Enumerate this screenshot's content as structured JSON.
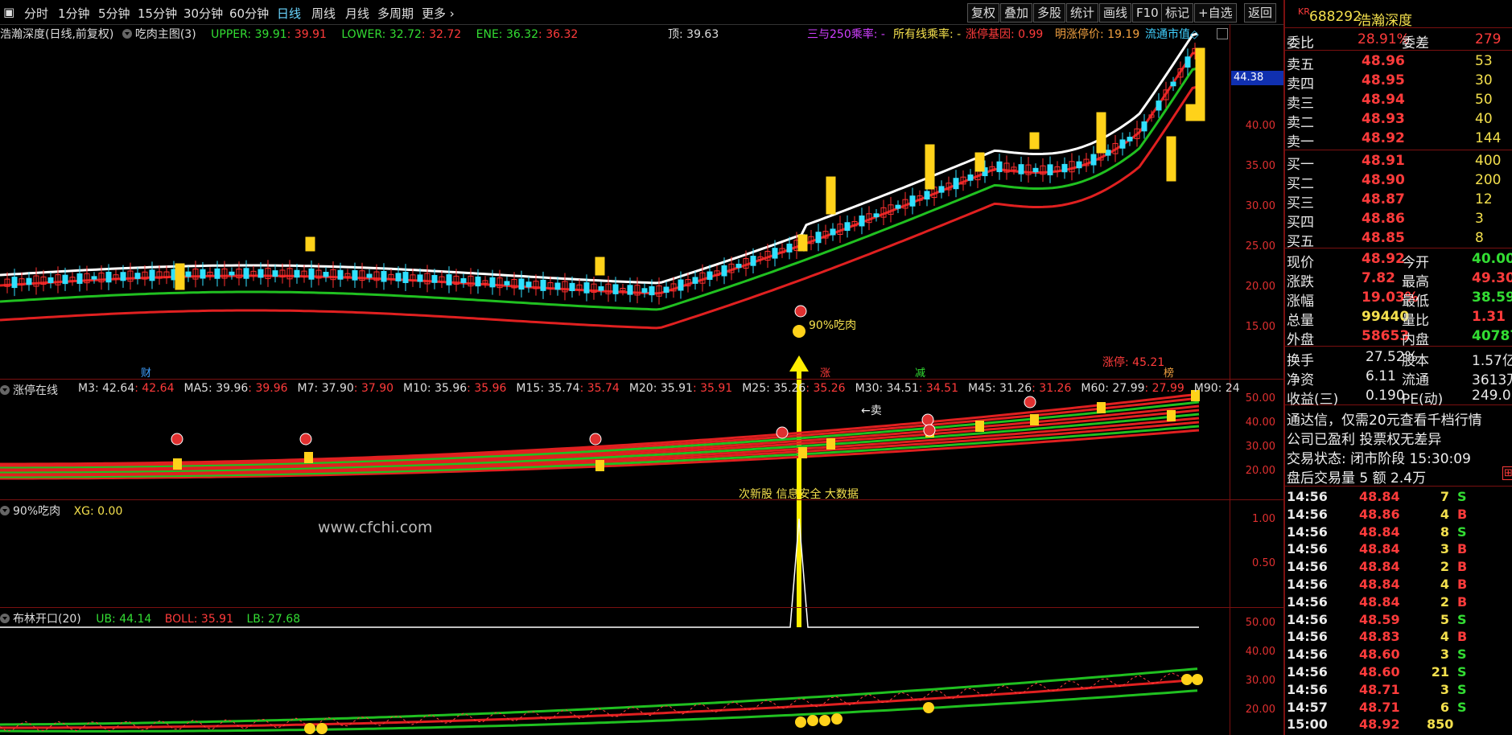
{
  "toolbar": {
    "period_tabs": [
      "分时",
      "1分钟",
      "5分钟",
      "15分钟",
      "30分钟",
      "60分钟",
      "日线",
      "周线",
      "月线",
      "多周期",
      "更多"
    ],
    "active_tab": "日线",
    "right_buttons": [
      "复权",
      "叠加",
      "多股",
      "统计",
      "画线",
      "F10",
      "标记",
      "+自选",
      "返回"
    ]
  },
  "main_panel": {
    "title": "浩瀚深度(日线,前复权)",
    "indicator_name": "吃肉主图(3)",
    "upper_label": "UPPER: 39.91",
    "upper_val": ": 39.91",
    "lower_label": "LOWER: 32.72",
    "lower_val": ": 32.72",
    "ene_label": "ENE: 36.32",
    "ene_val": ": 36.32",
    "top_label": "顶: 39.63",
    "extra1": "三与250乘率: -",
    "extra2": "所有线乘率: -",
    "extra3": "涨停基因: 0.99",
    "extra4": "明涨停价: 19.19",
    "extra5": "流通市值◇",
    "price_tag": "44.38",
    "signal_text": "90%吃肉",
    "limit_text": "涨停: 45.21",
    "marker_cai": "财",
    "marker_zhang": "涨",
    "marker_jian": "减",
    "marker_bang": "榜",
    "y_ticks": [
      "40.00",
      "35.00",
      "30.00",
      "25.00",
      "20.00",
      "15.00"
    ]
  },
  "panel2": {
    "name": "涨停在线",
    "ma": [
      {
        "l": "M3: 42.64",
        "v": ": 42.64"
      },
      {
        "l": "MA5: 39.96",
        "v": ": 39.96"
      },
      {
        "l": "M7: 37.90",
        "v": ": 37.90"
      },
      {
        "l": "M10: 35.96",
        "v": ": 35.96"
      },
      {
        "l": "M15: 35.74",
        "v": ": 35.74"
      },
      {
        "l": "M20: 35.91",
        "v": ": 35.91"
      },
      {
        "l": "M25: 35.26",
        "v": ": 35.26"
      },
      {
        "l": "M30: 34.51",
        "v": ": 34.51"
      },
      {
        "l": "M45: 31.26",
        "v": ": 31.26"
      },
      {
        "l": "M60: 27.99",
        "v": ": 27.99"
      },
      {
        "l": "M90: 24",
        "v": ""
      }
    ],
    "sell_text": "←卖",
    "news_text": "次新股 信息安全 大数据",
    "y_ticks": [
      "50.00",
      "40.00",
      "30.00",
      "20.00"
    ]
  },
  "panel3": {
    "name": "90%吃肉",
    "xg": "XG: 0.00",
    "watermark": "www.cfchi.com",
    "y_ticks": [
      "1.00",
      "0.50"
    ]
  },
  "panel4": {
    "name": "布林开口(20)",
    "ub": "UB: 44.14",
    "boll": "BOLL: 35.91",
    "lb": "LB: 27.68",
    "y_ticks": [
      "50.00",
      "40.00",
      "30.00",
      "20.00"
    ]
  },
  "quote": {
    "code_prefix": "KR",
    "code": "688292",
    "name": "浩瀚深度",
    "weibi_label": "委比",
    "weibi_val": "28.91%",
    "weicha_label": "委差",
    "weicha_val": "279",
    "asks": [
      {
        "l": "卖五",
        "p": "48.96",
        "v": "53"
      },
      {
        "l": "卖四",
        "p": "48.95",
        "v": "30"
      },
      {
        "l": "卖三",
        "p": "48.94",
        "v": "50"
      },
      {
        "l": "卖二",
        "p": "48.93",
        "v": "40"
      },
      {
        "l": "卖一",
        "p": "48.92",
        "v": "144"
      }
    ],
    "bids": [
      {
        "l": "买一",
        "p": "48.91",
        "v": "400"
      },
      {
        "l": "买二",
        "p": "48.90",
        "v": "200"
      },
      {
        "l": "买三",
        "p": "48.87",
        "v": "12"
      },
      {
        "l": "买四",
        "p": "48.86",
        "v": "3"
      },
      {
        "l": "买五",
        "p": "48.85",
        "v": "8"
      }
    ],
    "stats": [
      {
        "l1": "现价",
        "v1": "48.92",
        "l2": "今开",
        "v2": "40.00"
      },
      {
        "l1": "涨跌",
        "v1": "7.82",
        "l2": "最高",
        "v2": "49.30"
      },
      {
        "l1": "涨幅",
        "v1": "19.03%",
        "l2": "最低",
        "v2": "38.59"
      },
      {
        "l1": "总量",
        "v1": "99440",
        "l2": "量比",
        "v2": "1.31"
      },
      {
        "l1": "外盘",
        "v1": "58653",
        "l2": "内盘",
        "v2": "40787"
      }
    ],
    "stats2": [
      {
        "l1": "换手",
        "v1": "27.52%",
        "l2": "股本",
        "v2": "1.57亿"
      },
      {
        "l1": "净资",
        "v1": "6.11",
        "l2": "流通",
        "v2": "3613万"
      },
      {
        "l1": "收益(三)",
        "v1": "0.190",
        "l2": "PE(动)",
        "v2": "249.0"
      }
    ],
    "notice1": "通达信，仅需20元查看千档行情",
    "notice2": "公司已盈利 投票权无差异",
    "status": "交易状态: 闭市阶段 15:30:09",
    "after_hours": "盘后交易量 5 额 2.4万",
    "ticks": [
      {
        "t": "14:56",
        "p": "48.84",
        "v": "7",
        "s": "S"
      },
      {
        "t": "14:56",
        "p": "48.86",
        "v": "4",
        "s": "B"
      },
      {
        "t": "14:56",
        "p": "48.84",
        "v": "8",
        "s": "S"
      },
      {
        "t": "14:56",
        "p": "48.84",
        "v": "3",
        "s": "B"
      },
      {
        "t": "14:56",
        "p": "48.84",
        "v": "2",
        "s": "B"
      },
      {
        "t": "14:56",
        "p": "48.84",
        "v": "4",
        "s": "B"
      },
      {
        "t": "14:56",
        "p": "48.84",
        "v": "2",
        "s": "B"
      },
      {
        "t": "14:56",
        "p": "48.59",
        "v": "5",
        "s": "S"
      },
      {
        "t": "14:56",
        "p": "48.83",
        "v": "4",
        "s": "B"
      },
      {
        "t": "14:56",
        "p": "48.60",
        "v": "3",
        "s": "S"
      },
      {
        "t": "14:56",
        "p": "48.60",
        "v": "21",
        "s": "S"
      },
      {
        "t": "14:56",
        "p": "48.71",
        "v": "3",
        "s": "S"
      },
      {
        "t": "14:57",
        "p": "48.71",
        "v": "6",
        "s": "S"
      },
      {
        "t": "15:00",
        "p": "48.92",
        "v": "850",
        "s": ""
      }
    ],
    "colors": {
      "up": "#ff3b3b",
      "down": "#33dd33",
      "text": "#e8e8e8",
      "yellow": "#f4e04d"
    }
  }
}
